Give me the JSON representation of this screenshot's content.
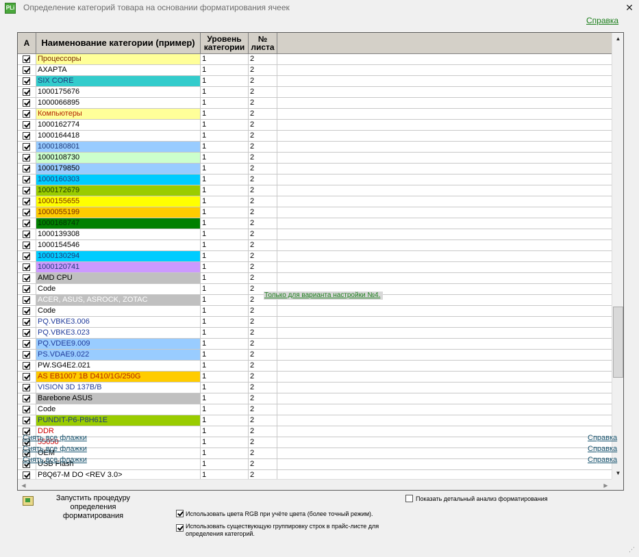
{
  "window": {
    "title": "Определение категорий товара на основании форматирования ячеек",
    "app_icon": "PLi",
    "close": "✕",
    "help_link": "Справка"
  },
  "grid": {
    "columns": [
      "A",
      "Наименование категории (пример)",
      "Уровень категории",
      "№ листа"
    ],
    "column_level_lines": [
      "Уровень",
      "категории"
    ],
    "column_sheet_lines": [
      "№",
      "листа"
    ],
    "rows": [
      {
        "name": "Процессоры",
        "level": "1",
        "sheet": "2",
        "bg": "#ffff99",
        "fg": "#7a2b00"
      },
      {
        "name": "AXAPTA",
        "level": "1",
        "sheet": "2",
        "bg": "#ffffff",
        "fg": "#000000"
      },
      {
        "name": "SIX CORE",
        "level": "1",
        "sheet": "2",
        "bg": "#33cccc",
        "fg": "#1f3a7a"
      },
      {
        "name": "1000175676",
        "level": "1",
        "sheet": "2",
        "bg": "#ffffff",
        "fg": "#000000"
      },
      {
        "name": "1000066895",
        "level": "1",
        "sheet": "2",
        "bg": "#ffffff",
        "fg": "#000000"
      },
      {
        "name": "Компьютеры",
        "level": "1",
        "sheet": "2",
        "bg": "#ffff99",
        "fg": "#b32400"
      },
      {
        "name": "1000162774",
        "level": "1",
        "sheet": "2",
        "bg": "#ffffff",
        "fg": "#000000"
      },
      {
        "name": "1000164418",
        "level": "1",
        "sheet": "2",
        "bg": "#ffffff",
        "fg": "#000000"
      },
      {
        "name": "1000180801",
        "level": "1",
        "sheet": "2",
        "bg": "#99ccff",
        "fg": "#1f3a7a"
      },
      {
        "name": "1000108730",
        "level": "1",
        "sheet": "2",
        "bg": "#ccffcc",
        "fg": "#000000"
      },
      {
        "name": "1000179850",
        "level": "1",
        "sheet": "2",
        "bg": "#99ccff",
        "fg": "#000000"
      },
      {
        "name": "1000160303",
        "level": "1",
        "sheet": "2",
        "bg": "#00ccff",
        "fg": "#1f3a7a"
      },
      {
        "name": "1000172679",
        "level": "1",
        "sheet": "2",
        "bg": "#99cc00",
        "fg": "#1f3a00"
      },
      {
        "name": "1000155655",
        "level": "1",
        "sheet": "2",
        "bg": "#ffff00",
        "fg": "#7a2b00"
      },
      {
        "name": "1000055199",
        "level": "1",
        "sheet": "2",
        "bg": "#ffcc00",
        "fg": "#7a2b00"
      },
      {
        "name": "1000168747",
        "level": "1",
        "sheet": "2",
        "bg": "#008000",
        "fg": "#003300"
      },
      {
        "name": "1000139308",
        "level": "1",
        "sheet": "2",
        "bg": "#ffffff",
        "fg": "#000000"
      },
      {
        "name": "1000154546",
        "level": "1",
        "sheet": "2",
        "bg": "#ffffff",
        "fg": "#000000"
      },
      {
        "name": "1000130294",
        "level": "1",
        "sheet": "2",
        "bg": "#00ccff",
        "fg": "#1f3a7a"
      },
      {
        "name": "1000120741",
        "level": "1",
        "sheet": "2",
        "bg": "#cc99ff",
        "fg": "#1f3a7a"
      },
      {
        "name": "AMD CPU",
        "level": "1",
        "sheet": "2",
        "bg": "#c0c0c0",
        "fg": "#000000"
      },
      {
        "name": "Code",
        "level": "1",
        "sheet": "2",
        "bg": "#ffffff",
        "fg": "#000000"
      },
      {
        "name": "ACER, ASUS, ASROCK, ZOTAC",
        "level": "1",
        "sheet": "2",
        "bg": "#c0c0c0",
        "fg": "#ffffff"
      },
      {
        "name": "Code",
        "level": "1",
        "sheet": "2",
        "bg": "#ffffff",
        "fg": "#000000"
      },
      {
        "name": "PQ.VBKE3.006",
        "level": "1",
        "sheet": "2",
        "bg": "#ffffff",
        "fg": "#1f3a9a"
      },
      {
        "name": "PQ.VBKE3.023",
        "level": "1",
        "sheet": "2",
        "bg": "#ffffff",
        "fg": "#1f3a9a"
      },
      {
        "name": "PQ.VDEE9.009",
        "level": "1",
        "sheet": "2",
        "bg": "#99ccff",
        "fg": "#1f3a9a"
      },
      {
        "name": "PS.VDAE9.022",
        "level": "1",
        "sheet": "2",
        "bg": "#99ccff",
        "fg": "#1f3a9a"
      },
      {
        "name": "PW.SG4E2.021",
        "level": "1",
        "sheet": "2",
        "bg": "#ffffff",
        "fg": "#000000"
      },
      {
        "name": "AS EB1007 1B D410/1G/250G",
        "level": "1",
        "sheet": "2",
        "bg": "#ffcc00",
        "fg": "#b32400"
      },
      {
        "name": "VISION 3D 137B/B",
        "level": "1",
        "sheet": "2",
        "bg": "#ffffff",
        "fg": "#1f3a9a"
      },
      {
        "name": "Barebone ASUS",
        "level": "1",
        "sheet": "2",
        "bg": "#c0c0c0",
        "fg": "#000000"
      },
      {
        "name": "Code",
        "level": "1",
        "sheet": "2",
        "bg": "#ffffff",
        "fg": "#000000"
      },
      {
        "name": "PUNDIT-P6-P8H61E",
        "level": "1",
        "sheet": "2",
        "bg": "#99cc00",
        "fg": "#1f3a7a"
      },
      {
        "name": "DDR",
        "level": "1",
        "sheet": "2",
        "bg": "#ffffff",
        "fg": "#cc0000"
      },
      {
        "name": "55050",
        "level": "1",
        "sheet": "2",
        "bg": "#ffffff",
        "fg": "#cc0000"
      },
      {
        "name": "OEM",
        "level": "1",
        "sheet": "2",
        "bg": "#ffffff",
        "fg": "#000000"
      },
      {
        "name": "USB Flash",
        "level": "1",
        "sheet": "2",
        "bg": "#ffffff",
        "fg": "#000000"
      },
      {
        "name": "P8Q67-M DO <REV 3.0>",
        "level": "1",
        "sheet": "2",
        "bg": "#ffffff",
        "fg": "#000000"
      }
    ],
    "note": "Только для варианта настройки №4."
  },
  "overlays": {
    "uncheck_all": "Снять все флажки",
    "help": "Справка"
  },
  "bottom": {
    "run_line1": "Запустить процедуру",
    "run_line2": "определения форматирования",
    "detail_analysis": "Показать детальный анализ форматирования",
    "use_rgb": "Использовать цвета RGB при учёте цвета (более точный режим).",
    "use_grouping_line1": "Использовать существующую группировку строк в прайс-листе для",
    "use_grouping_line2": "определения категорий."
  }
}
